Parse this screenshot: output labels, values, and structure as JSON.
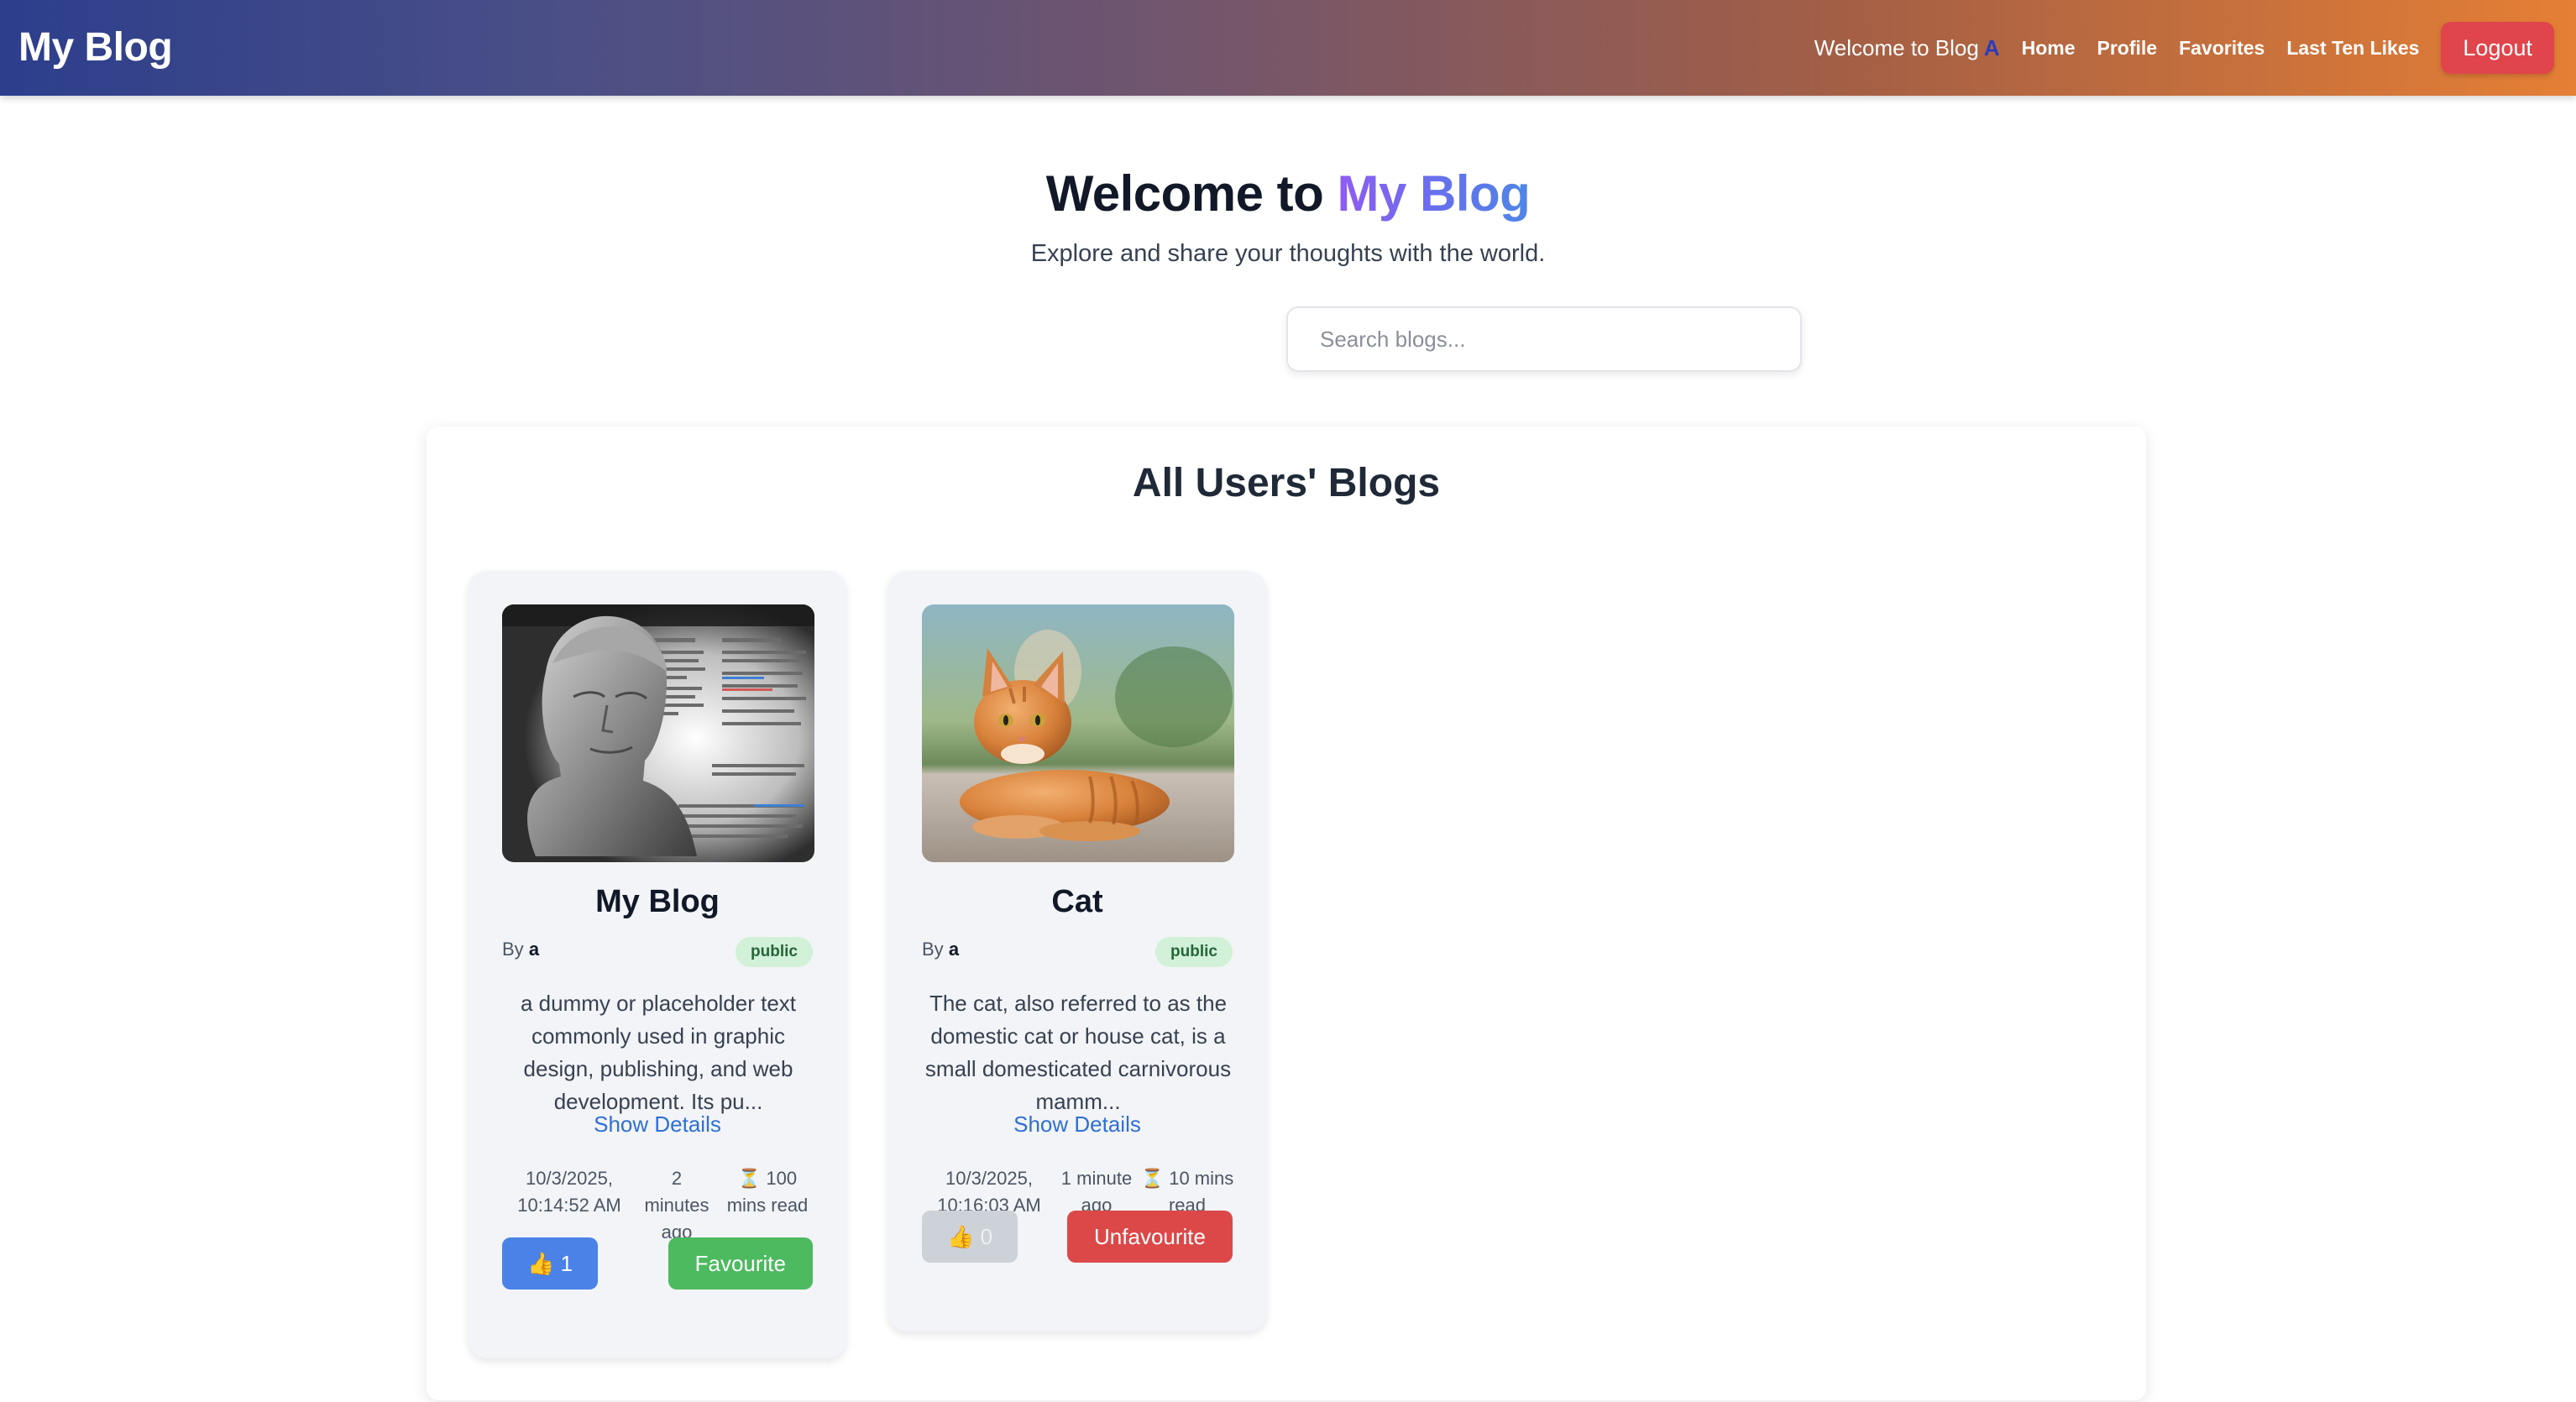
{
  "navbar": {
    "brand": "My Blog",
    "welcome_text": "Welcome to Blog",
    "username": "A",
    "links": [
      "Home",
      "Profile",
      "Favorites",
      "Last Ten Likes"
    ],
    "logout_label": "Logout"
  },
  "hero": {
    "title_prefix": "Welcome to",
    "title_highlight": "My Blog",
    "subtitle": "Explore and share your thoughts with the world."
  },
  "search": {
    "placeholder": "Search blogs..."
  },
  "panel": {
    "title": "All Users' Blogs"
  },
  "blogs": [
    {
      "title": "My Blog",
      "by_label": "By",
      "author": "a",
      "visibility": "public",
      "excerpt": "a dummy or placeholder text commonly used in graphic design, publishing, and web development. Its pu...",
      "show_details": "Show Details",
      "date": "10/3/2025, 10:14:52 AM",
      "ago": "2 minutes ago",
      "read_time": "⏳ 100 mins read",
      "likes": "👍 1",
      "favourite_label": "Favourite",
      "image": "statue-bust-with-lorem-ipsum-text"
    },
    {
      "title": "Cat",
      "by_label": "By",
      "author": "a",
      "visibility": "public",
      "excerpt": "The cat, also referred to as the domestic cat or house cat, is a small domesticated carnivorous mamm...",
      "show_details": "Show Details",
      "date": "10/3/2025, 10:16:03 AM",
      "ago": "1 minute ago",
      "read_time": "⏳ 10 mins read",
      "likes": "👍 0",
      "favourite_label": "Unfavourite",
      "image": "orange-tabby-cat"
    }
  ],
  "colors": {
    "nav_gradient_start": "#2c3e8c",
    "nav_gradient_end": "#e57f35",
    "logout": "#e0454c",
    "like_active": "#4b82e8",
    "favourite": "#4dba5f",
    "unfavourite": "#dc4848",
    "link": "#2f6fd4",
    "badge_bg": "#d1f1d8"
  }
}
